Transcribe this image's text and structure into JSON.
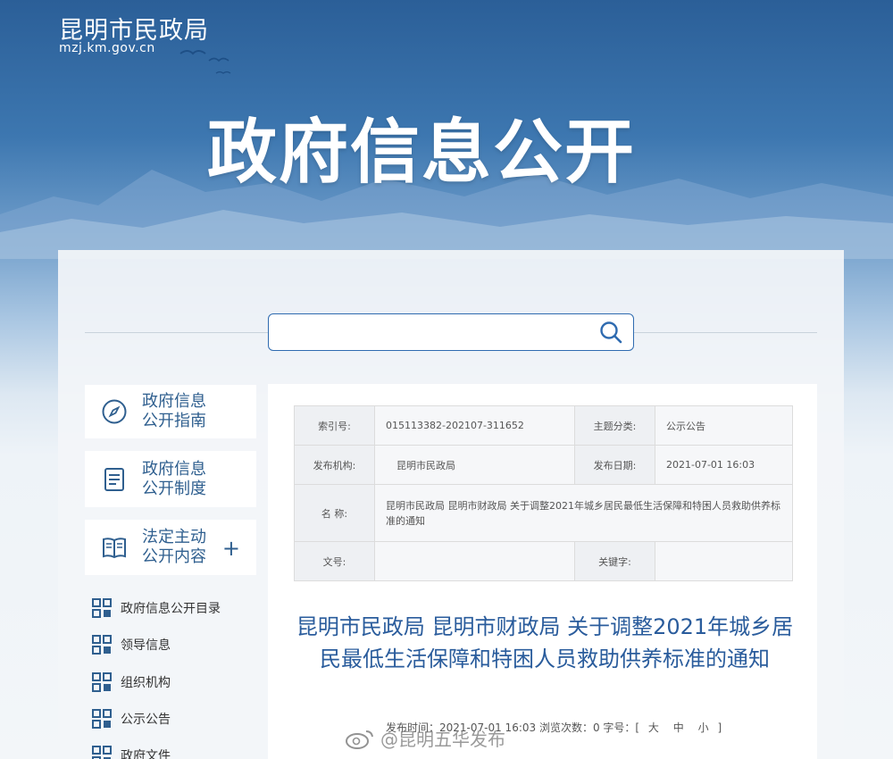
{
  "header": {
    "site_name": "昆明市民政局",
    "site_url": "mzj.km.gov.cn",
    "hero_title": "政府信息公开"
  },
  "search": {
    "placeholder": "",
    "icon": "search-icon"
  },
  "sidebar": {
    "cards": [
      {
        "label": "政府信息\n公开指南",
        "icon": "compass-icon"
      },
      {
        "label": "政府信息\n公开制度",
        "icon": "document-icon"
      },
      {
        "label": "法定主动\n公开内容",
        "icon": "book-icon",
        "expand": "+"
      }
    ],
    "items": [
      {
        "label": "政府信息公开目录"
      },
      {
        "label": "领导信息"
      },
      {
        "label": "组织机构"
      },
      {
        "label": "公示公告"
      },
      {
        "label": "政府文件"
      }
    ]
  },
  "meta": {
    "index_label": "索引号:",
    "index_value": "015113382-202107-311652",
    "category_label": "主题分类:",
    "category_value": "公示公告",
    "issuer_label": "发布机构:",
    "issuer_value": "昆明市民政局",
    "date_label": "发布日期:",
    "date_value": "2021-07-01 16:03",
    "name_label": "名  称:",
    "name_value": "昆明市民政局 昆明市财政局 关于调整2021年城乡居民最低生活保障和特困人员救助供养标准的通知",
    "docno_label": "文号:",
    "docno_value": "",
    "keyword_label": "关键字:",
    "keyword_value": ""
  },
  "article": {
    "title": "昆明市民政局 昆明市财政局 关于调整2021年城乡居民最低生活保障和特困人员救助供养标准的通知",
    "pub_prefix": "发布时间：2021-07-01 16:03 浏览次数：0 字号：[",
    "size_large": "大",
    "size_medium": "中",
    "size_small": "小",
    "pub_suffix": "]"
  },
  "watermark": {
    "text": "@昆明五华发布"
  }
}
